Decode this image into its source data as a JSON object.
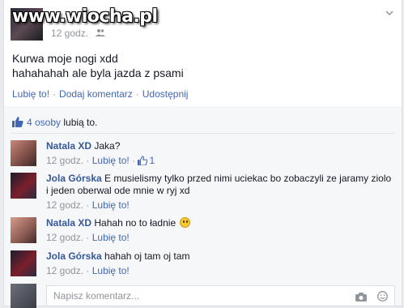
{
  "watermark": "www.wiocha.pl",
  "post": {
    "time": "12 godz.",
    "audience_icon": "friends-icon",
    "lines": [
      "Kurwa moje nogi xdd",
      "hahahahah ale byla jazda z psami"
    ],
    "actions": {
      "like": "Lubię to!",
      "comment": "Dodaj komentarz",
      "share": "Udostępnij",
      "separator": "·"
    }
  },
  "likes": {
    "count": "4 osoby",
    "suffix": " lubią to."
  },
  "comments": [
    {
      "name": "Natala XD",
      "text": "Jaka?",
      "time": "12 godz.",
      "like": "Lubię to!",
      "like_count": "1"
    },
    {
      "name": "Jola Górska",
      "text": "E musielismy tylko przed nimi uciekac bo zobaczyli ze jaramy ziolo i jeden oberwal ode mnie w ryj xd",
      "time": "12 godz.",
      "like": "Lubię to!"
    },
    {
      "name": "Natala XD",
      "text": "Hahah no to ładnie",
      "time": "12 godz.",
      "like": "Lubię to!"
    },
    {
      "name": "Jola Górska",
      "text": "hahah oj tam oj tam",
      "time": "12 godz.",
      "like": "Lubię to!"
    }
  ],
  "composer": {
    "placeholder": "Napisz komentarz...",
    "icons": [
      "camera-icon",
      "emoji-icon"
    ]
  },
  "colors": {
    "link": "#4267b2",
    "name": "#365899",
    "meta": "#90949c",
    "background": "#f6f7f9"
  }
}
